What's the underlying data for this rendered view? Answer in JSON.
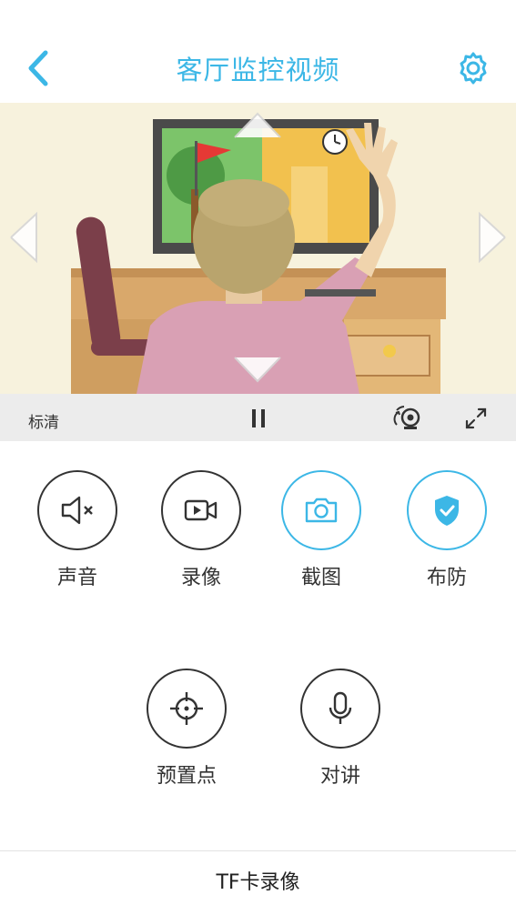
{
  "header": {
    "title": "客厅监控视频",
    "back_icon": "chevron-left-icon",
    "settings_icon": "gear-icon"
  },
  "video": {
    "quality_label": "标清",
    "pause_icon": "pause-icon",
    "camera_switch_icon": "camera-switch-icon",
    "fullscreen_icon": "fullscreen-icon"
  },
  "actions": [
    {
      "label": "声音",
      "icon": "speaker-mute-icon",
      "active": false
    },
    {
      "label": "录像",
      "icon": "video-record-icon",
      "active": false
    },
    {
      "label": "截图",
      "icon": "camera-icon",
      "active": true
    },
    {
      "label": "布防",
      "icon": "shield-check-icon",
      "active": true
    },
    {
      "label": "预置点",
      "icon": "crosshair-icon",
      "active": false
    },
    {
      "label": "对讲",
      "icon": "microphone-icon",
      "active": false
    }
  ],
  "footer": {
    "tf_label": "TF卡录像"
  },
  "colors": {
    "accent": "#3cb7e6",
    "text": "#333333",
    "bar": "#ececec"
  }
}
